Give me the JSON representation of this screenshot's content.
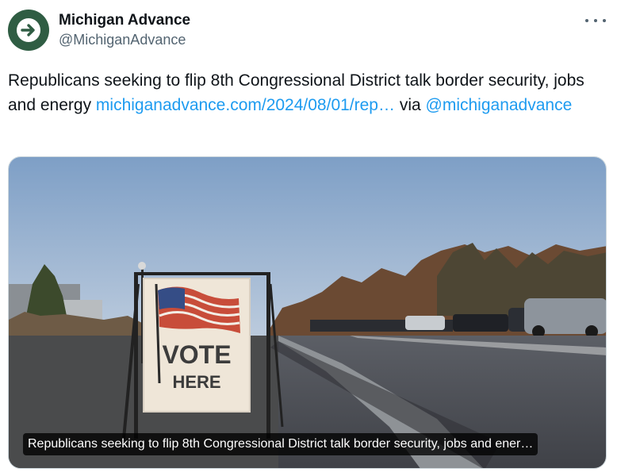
{
  "author": {
    "display_name": "Michigan Advance",
    "handle": "@MichiganAdvance",
    "avatar_icon": "arrow-right-circle-icon",
    "avatar_color": "#2f5d43"
  },
  "menu": {
    "icon": "more-horizontal-icon"
  },
  "tweet": {
    "text_before_link": "Republicans seeking to flip 8th Congressional District talk border security, jobs and energy ",
    "link_text": "michiganadvance.com/2024/08/01/rep…",
    "text_between": " via ",
    "mention": "@michiganadvance",
    "link_color": "#1d9bf0"
  },
  "media": {
    "sign_line1": "VOTE",
    "sign_line2": "HERE",
    "caption": "Republicans seeking to flip 8th Congressional District talk border security, jobs and ener…"
  }
}
